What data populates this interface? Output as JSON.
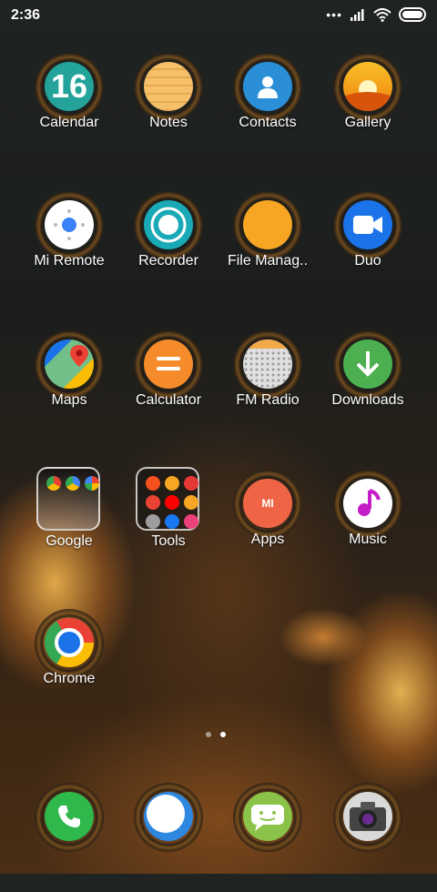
{
  "status_bar": {
    "time": "2:36",
    "more": "•••"
  },
  "apps": [
    {
      "label": "Calendar"
    },
    {
      "label": "Notes"
    },
    {
      "label": "Contacts"
    },
    {
      "label": "Gallery"
    },
    {
      "label": "Mi Remote"
    },
    {
      "label": "Recorder"
    },
    {
      "label": "File Manag.."
    },
    {
      "label": "Duo"
    },
    {
      "label": "Maps"
    },
    {
      "label": "Calculator"
    },
    {
      "label": "FM Radio"
    },
    {
      "label": "Downloads"
    },
    {
      "label": "Google"
    },
    {
      "label": "Tools"
    },
    {
      "label": "Apps"
    },
    {
      "label": "Music"
    },
    {
      "label": "Chrome"
    }
  ],
  "calendar_day": "16",
  "apps_logo": "MI",
  "pages": {
    "count": 2,
    "active": 2
  },
  "colors": {
    "calendar": "#23a39a",
    "notes": "#f6c06b",
    "contacts": "#2b8fd8",
    "gallery": "#f5a81c",
    "mi_remote": "#ffffff",
    "recorder": "#1aa9b7",
    "file_manager": "#f6a623",
    "duo": "#1a73e8",
    "calculator": "#f58b2a",
    "downloads": "#4caf50",
    "apps": "#f06446",
    "music": "#ffffff",
    "phone": "#2fb84b",
    "messages": "#2e88e0",
    "sms": "#8bc34a",
    "camera": "#9e9e9e"
  },
  "dock": [
    {
      "icon": "phone-icon"
    },
    {
      "icon": "messages-icon"
    },
    {
      "icon": "sms-icon"
    },
    {
      "icon": "camera-icon"
    }
  ]
}
